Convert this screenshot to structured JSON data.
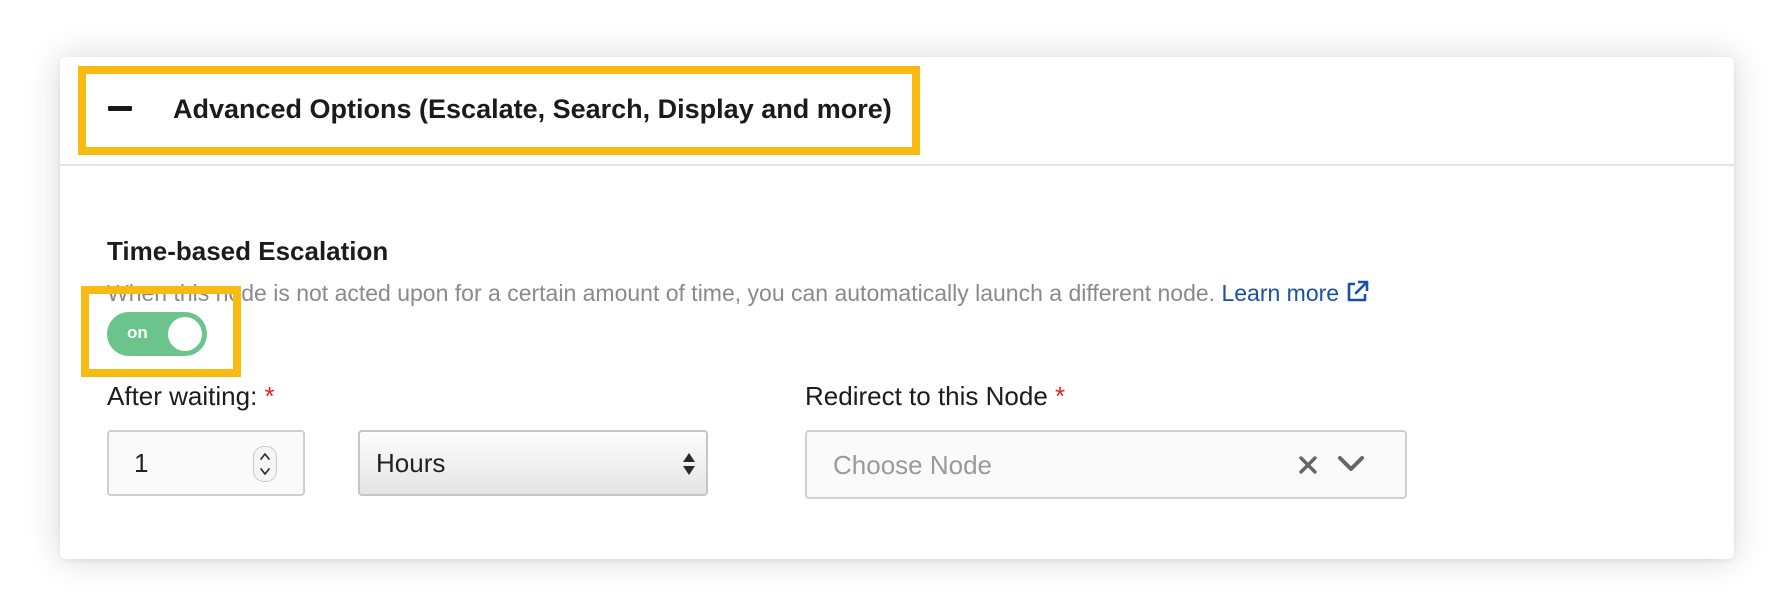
{
  "panel": {
    "title": "Advanced Options (Escalate, Search, Display and more)",
    "collapse_icon": "minus-icon"
  },
  "escalation": {
    "title": "Time-based Escalation",
    "description": "When this node is not acted upon for a certain amount of time, you can automatically launch a different node.",
    "learn_more": "Learn more",
    "learn_more_icon": "external-link-icon",
    "toggle": {
      "label": "on",
      "state": true
    }
  },
  "fields": {
    "after_waiting": {
      "label": "After waiting:",
      "required_mark": "*",
      "value": "1",
      "unit": "Hours"
    },
    "redirect": {
      "label": "Redirect to this Node",
      "required_mark": "*",
      "placeholder": "Choose Node"
    }
  },
  "colors": {
    "highlight": "#f9bb12",
    "toggle_on": "#6cc48d",
    "link": "#1a4fa8",
    "required": "#e0231c"
  }
}
